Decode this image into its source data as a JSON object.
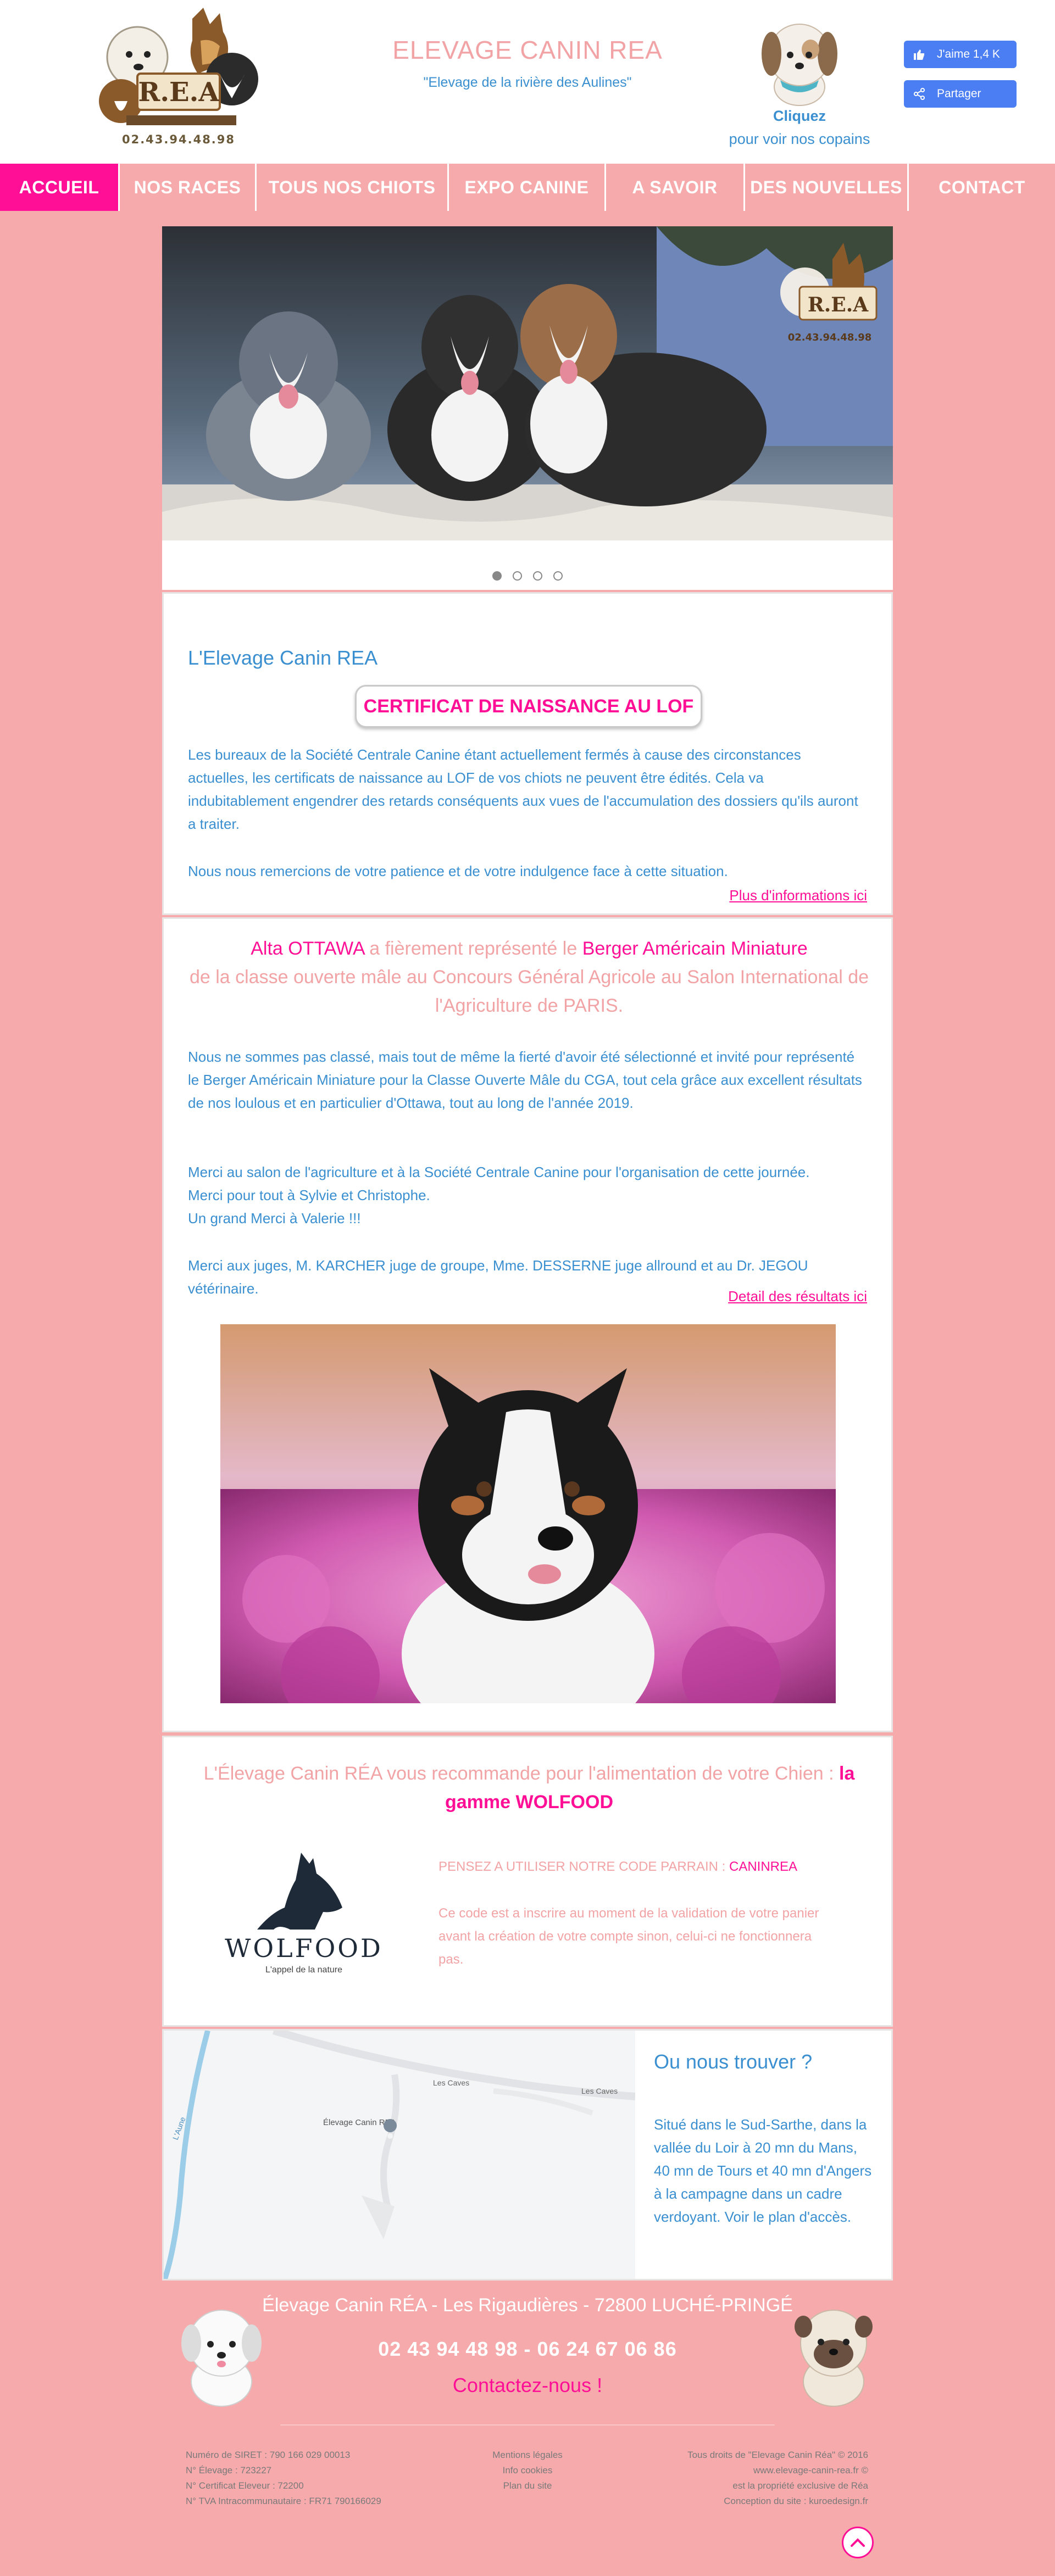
{
  "header": {
    "logo_phone": "02.43.94.48.98",
    "logo_letters": "R.E.A",
    "title": "ELEVAGE CANIN REA",
    "subtitle": "\"Elevage de la rivière des Aulines\"",
    "copains_title": "Cliquez",
    "copains_sub": "pour voir nos copains",
    "fb_like": "J'aime 1,4 K",
    "fb_share": "Partager"
  },
  "nav": [
    {
      "label": "ACCUEIL",
      "active": true
    },
    {
      "label": "NOS RACES",
      "active": false
    },
    {
      "label": "TOUS NOS CHIOTS",
      "active": false
    },
    {
      "label": "EXPO CANINE",
      "active": false
    },
    {
      "label": "A SAVOIR",
      "active": false
    },
    {
      "label": "DES NOUVELLES",
      "active": false
    },
    {
      "label": "CONTACT",
      "active": false
    }
  ],
  "slider": {
    "phone": "02.43.94.48.98",
    "slide_count": 4,
    "active_slide": 1
  },
  "card1": {
    "title": "L'Elevage Canin REA",
    "button": "CERTIFICAT DE NAISSANCE AU LOF",
    "para1": "Les bureaux de la Société Centrale Canine étant actuellement fermés à cause des circonstances actuelles, les certificats de naissance au LOF de vos chiots ne peuvent être édités. Cela va indubitablement engendrer des retards conséquents aux vues de l'accumulation des dossiers qu'ils auront a traiter.",
    "para2": "Nous nous remercions de votre patience et de votre indulgence face à cette situation.",
    "link": "Plus d'informations ici"
  },
  "card2": {
    "head_name": "Alta OTTAWA",
    "head_mid": " a fièrement représenté le ",
    "head_breed": "Berger Américain Miniature",
    "head_rest": "de la classe ouverte mâle au Concours Général Agricole au Salon International de l'Agriculture de PARIS.",
    "para1": "Nous ne sommes pas classé, mais tout de même la fierté d'avoir été sélectionné et invité pour représenté le Berger Américain Miniature pour la Classe Ouverte Mâle du CGA, tout cela grâce aux excellent résultats de nos loulous et en particulier d'Ottawa, tout au long de l'année 2019.",
    "thanks1": "Merci au salon de l'agriculture et à la Société Centrale Canine pour l'organisation de cette journée.",
    "thanks2": "Merci pour tout à Sylvie et Christophe.",
    "thanks3": "Un grand Merci à Valerie  !!!",
    "judges": "Merci aux juges, M. KARCHER juge de groupe, Mme. DESSERNE juge allround et au Dr. JEGOU vétérinaire.",
    "link": "Detail des résultats ici"
  },
  "card3": {
    "head": "L'Élevage Canin RÉA vous recommande pour l'alimentation de votre Chien : ",
    "head_brand": "la gamme WOLFOOD",
    "logo_word": "WOLFOOD",
    "logo_tag": "L'appel de la nature",
    "code_label": "PENSEZ A UTILISER NOTRE CODE PARRAIN : ",
    "code": "CANINREA",
    "note": "Ce code est a inscrire au moment de la validation de votre panier avant la création de votre compte sinon, celui-ci ne fonctionnera pas."
  },
  "map": {
    "pin_label": "Élevage Canin REA",
    "road1": "Les Caves",
    "road2": "Les Caves",
    "river": "L'Aune",
    "title": "Ou nous trouver ?",
    "text": "Situé dans le Sud-Sarthe, dans la vallée du Loir à 20 mn du Mans, 40 mn de Tours et 40 mn d'Angers à la campagne dans un cadre verdoyant. Voir le plan d'accès."
  },
  "footer": {
    "address": "Élevage Canin RÉA - Les Rigaudières - 72800 LUCHÉ-PRINGÉ",
    "phone1": "02 43 94 48 98",
    "phone_sep": " - ",
    "phone2": "06 24 67 06 86",
    "contact": "Contactez-nous !",
    "left": [
      "Numéro de SIRET : 790 166 029 00013",
      "N° Élevage : 723227",
      "N° Certificat Eleveur : 72200",
      "N° TVA Intracommunautaire : FR71 790166029"
    ],
    "mid": [
      "Mentions légales",
      "Info cookies",
      "Plan du site"
    ],
    "right": [
      "Tous droits de \"Elevage Canin Réa\" © 2016",
      "www.elevage-canin-rea.fr ©",
      "est la propriété exclusive de Réa",
      "Conception du site : kuroedesign.fr"
    ]
  },
  "colors": {
    "background": "#f7aaac",
    "accent": "#ff0f95",
    "text_blue": "#3a8fd0",
    "soft_pink": "#f2a3a5",
    "facebook": "#4a7ef2"
  }
}
